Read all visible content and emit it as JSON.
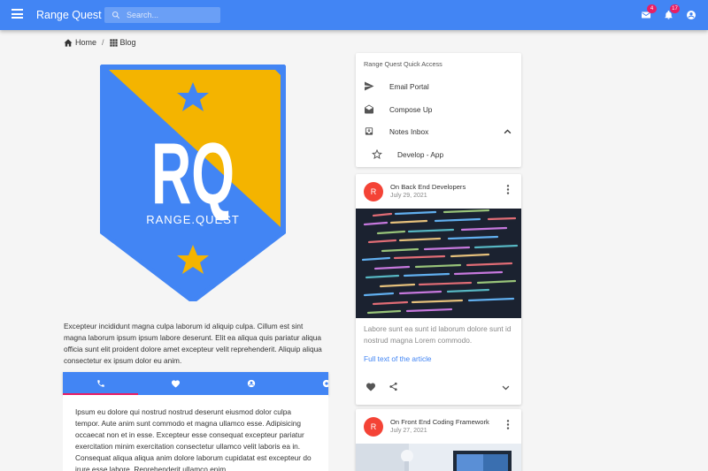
{
  "app": {
    "title": "Range Quest",
    "search_placeholder": "Search...",
    "mail_badge": "4",
    "notification_badge": "17",
    "brand_color": "#4285f4",
    "accent_color": "#e91e63"
  },
  "breadcrumb": {
    "home": "Home",
    "blog": "Blog"
  },
  "logo": {
    "initials": "RQ",
    "wordmark": "RANGE.QUEST"
  },
  "intro": "Excepteur incididunt magna culpa laborum id aliquip culpa. Cillum est sint magna laborum ipsum ipsum labore deserunt. Elit ea aliqua quis pariatur aliqua officia sunt elit proident dolore amet excepteur velit reprehenderit. Aliquip aliqua consectetur ex ipsum dolor eu anim.",
  "tabs": [
    {
      "icon": "phone-icon"
    },
    {
      "icon": "heart-icon"
    },
    {
      "icon": "account-icon"
    },
    {
      "icon": "help-icon"
    }
  ],
  "tab_panel": "Ipsum eu dolore qui nostrud nostrud deserunt eiusmod dolor culpa tempor. Aute anim sunt commodo et magna ullamco esse. Adipisicing occaecat non et in esse. Excepteur esse consequat excepteur pariatur exercitation minim exercitation consectetur ullamco velit laboris ea in. Consequat aliqua aliqua anim dolore laborum cupidatat est excepteur do irure esse labore. Reprehenderit ullamco enim",
  "quick_access": {
    "title": "Range Quest Quick Access",
    "items": [
      {
        "label": "Email Portal",
        "icon": "send-icon"
      },
      {
        "label": "Compose Up",
        "icon": "drafts-icon"
      },
      {
        "label": "Notes Inbox",
        "icon": "inbox-icon"
      },
      {
        "label": "Develop - App",
        "icon": "star-outline-icon"
      }
    ]
  },
  "cards": [
    {
      "avatar": "R",
      "title": "On Back End Developers",
      "date": "July 29, 2021",
      "text": "Labore sunt ea sunt id laborum dolore sunt id nostrud magna Lorem commodo.",
      "link": "Full text of the article"
    },
    {
      "avatar": "R",
      "title": "On Front End Coding Framework",
      "date": "July 27, 2021"
    }
  ]
}
